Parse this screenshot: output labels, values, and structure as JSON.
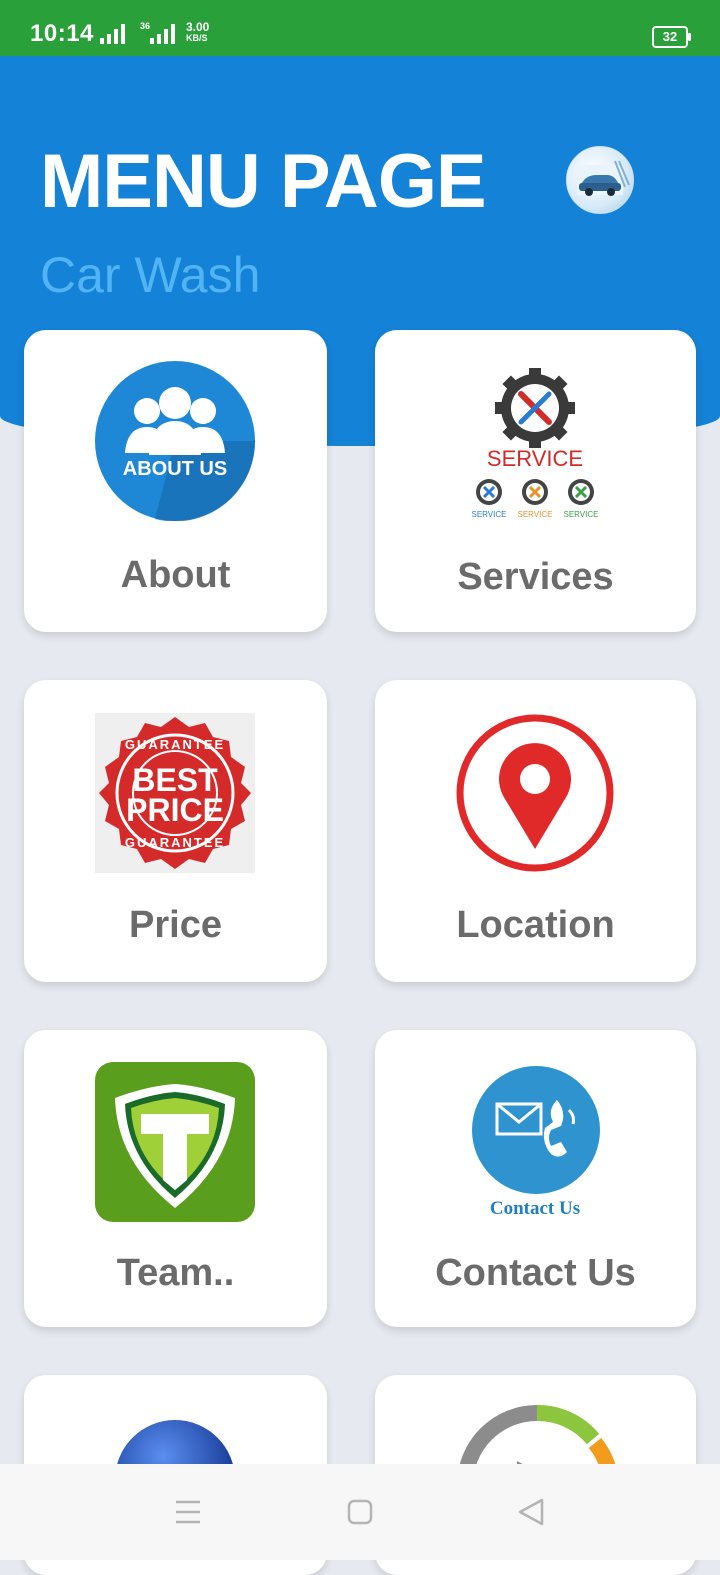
{
  "status_bar": {
    "time": "10:14",
    "network_label_top": "36",
    "speed_value": "3.00",
    "speed_unit": "KB/S",
    "battery": "32",
    "color": "#2aa03a"
  },
  "header": {
    "title": "MENU PAGE",
    "subtitle": "Car Wash",
    "background": "#1482d6"
  },
  "menu": {
    "items": [
      {
        "label": "About",
        "icon": "about-us-icon",
        "icon_text": "ABOUT US"
      },
      {
        "label": "Services",
        "icon": "service-gear-icon",
        "icon_text": "SERVICE",
        "sub_icon_text": "SERVICE"
      },
      {
        "label": "Price",
        "icon": "best-price-badge-icon",
        "icon_text_1": "BEST",
        "icon_text_2": "PRICE",
        "ring_text": "GUARANTEE"
      },
      {
        "label": "Location",
        "icon": "location-pin-icon"
      },
      {
        "label": "Team..",
        "icon": "team-shield-icon"
      },
      {
        "label": "Contact Us",
        "icon": "contact-phone-mail-icon",
        "icon_text": "Contact Us"
      },
      {
        "label": "",
        "icon": "blue-globe-icon"
      },
      {
        "label": "",
        "icon": "progress-ring-icon"
      }
    ]
  },
  "nav": {
    "menu": "menu-lines-icon",
    "home": "home-square-icon",
    "back": "back-triangle-icon"
  }
}
